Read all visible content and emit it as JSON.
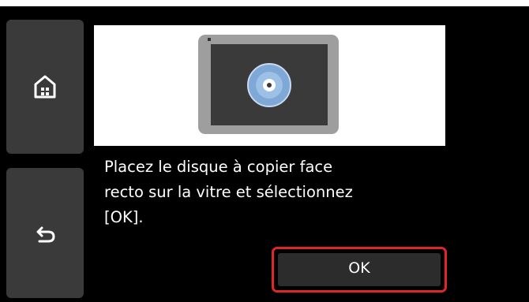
{
  "sidebar": {
    "home_icon": "home-icon",
    "back_icon": "back-arrow-icon"
  },
  "illustration": {
    "icon": "disc-on-glass-icon"
  },
  "message": {
    "text": "Placez le disque à copier face\nrecto sur la vitre et sélectionnez\n[OK]."
  },
  "actions": {
    "ok_label": "OK"
  },
  "colors": {
    "screen_background": "#000000",
    "button_background": "#3a3a3a",
    "ok_highlight": "#e0262b",
    "platen_gray": "#9e9e9e",
    "disc_blue": "#7fa8d6"
  }
}
